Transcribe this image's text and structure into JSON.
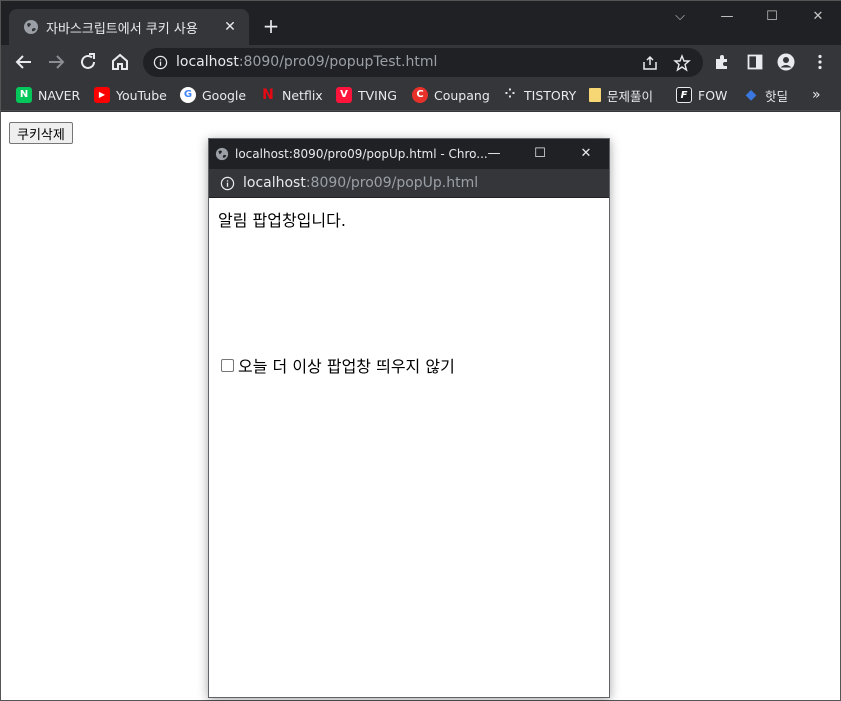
{
  "tab": {
    "title": "자바스크립트에서 쿠키 사용",
    "close": "✕",
    "new": "+"
  },
  "window_controls": {
    "dropdown": "⌵",
    "minimize": "—",
    "maximize": "☐",
    "close": "✕"
  },
  "address": {
    "host": "localhost",
    "rest": ":8090/pro09/popupTest.html"
  },
  "bookmarks": [
    {
      "label": "NAVER",
      "icon": "naver-icon",
      "color": "#03c75a",
      "glyph": "N"
    },
    {
      "label": "YouTube",
      "icon": "youtube-icon",
      "color": "#ff0000",
      "glyph": "▶"
    },
    {
      "label": "Google",
      "icon": "google-icon",
      "color": "#ffffff",
      "glyph": "G"
    },
    {
      "label": "Netflix",
      "icon": "netflix-icon",
      "color": "#35363a",
      "glyph": "N"
    },
    {
      "label": "TVING",
      "icon": "tving-icon",
      "color": "#ff153c",
      "glyph": "V"
    },
    {
      "label": "Coupang",
      "icon": "coupang-icon",
      "color": "#e8312a",
      "glyph": "C"
    },
    {
      "label": "TISTORY",
      "icon": "tistory-icon",
      "color": "#35363a",
      "glyph": "⁘"
    },
    {
      "label": "문제풀이",
      "icon": "folder-icon",
      "color": "#f7d774",
      "glyph": ""
    },
    {
      "label": "FOW",
      "icon": "fow-icon",
      "color": "#35363a",
      "glyph": "F"
    },
    {
      "label": "핫딜",
      "icon": "hotdeal-icon",
      "color": "#1a4fb3",
      "glyph": "◆"
    }
  ],
  "bookmarks_overflow": "»",
  "page": {
    "delete_cookie_button": "쿠키삭제"
  },
  "popup": {
    "title": "localhost:8090/pro09/popUp.html - Chro...",
    "url_host": "localhost",
    "url_rest": ":8090/pro09/popUp.html",
    "notice": "알림 팝업창입니다.",
    "checkbox_label": "오늘 더 이상 팝업창 띄우지 않기",
    "checkbox_checked": false,
    "controls": {
      "minimize": "—",
      "maximize": "☐",
      "close": "✕"
    }
  },
  "colors": {
    "frame": "#202124",
    "toolbar": "#35363a",
    "text": "#e8eaed",
    "muted": "#9aa0a6"
  }
}
